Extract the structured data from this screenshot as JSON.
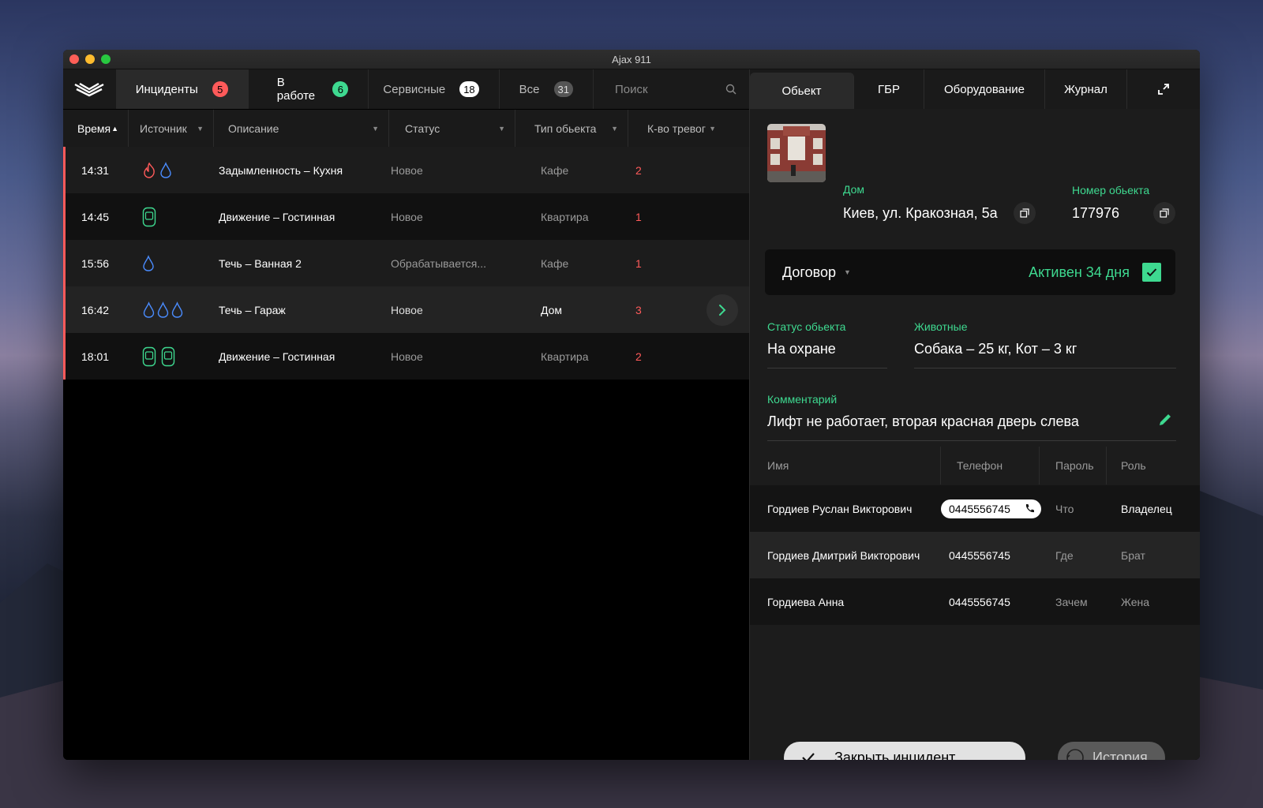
{
  "window": {
    "title": "Ajax 911"
  },
  "nav": {
    "tabs": [
      {
        "label": "Инциденты",
        "count": "5",
        "color": "#ff5a5a"
      },
      {
        "label": "В работе",
        "count": "6",
        "color": "#3ed990"
      },
      {
        "label": "Сервисные",
        "count": "18",
        "color": "#ffffff"
      },
      {
        "label": "Все",
        "count": "31",
        "color": "#555555"
      }
    ],
    "search_placeholder": "Поиск"
  },
  "table": {
    "columns": [
      "Время",
      "Источник",
      "Описание",
      "Статус",
      "Тип обьекта",
      "К-во тревог"
    ],
    "rows": [
      {
        "time": "14:31",
        "sources": [
          "fire-icon",
          "water-drop-icon"
        ],
        "description": "Задымленность – Кухня",
        "status": "Новое",
        "type": "Кафе",
        "count": "2"
      },
      {
        "time": "14:45",
        "sources": [
          "motion-sensor-icon"
        ],
        "description": "Движение – Гостинная",
        "status": "Новое",
        "type": "Квартира",
        "count": "1"
      },
      {
        "time": "15:56",
        "sources": [
          "water-drop-icon"
        ],
        "description": "Течь – Ванная 2",
        "status": "Обрабатывается...",
        "type": "Кафе",
        "count": "1"
      },
      {
        "time": "16:42",
        "sources": [
          "water-drop-icon",
          "water-drop-icon",
          "water-drop-icon"
        ],
        "description": "Течь – Гараж",
        "status": "Новое",
        "type": "Дом",
        "count": "3"
      },
      {
        "time": "18:01",
        "sources": [
          "motion-sensor-icon",
          "motion-sensor-icon"
        ],
        "description": "Движение – Гостинная",
        "status": "Новое",
        "type": "Квартира",
        "count": "2"
      }
    ]
  },
  "detail": {
    "tabs": [
      "Обьект",
      "ГБР",
      "Оборудование",
      "Журнал"
    ],
    "object_type_label": "Дом",
    "address": "Киев, ул. Кракозная, 5а",
    "number_label": "Номер обьекта",
    "number": "177976",
    "contract_label": "Договор",
    "contract_status": "Активен 34 дня",
    "status_label": "Статус обьекта",
    "status_value": "На охране",
    "animals_label": "Животные",
    "animals_value": "Собака – 25 кг, Кот – 3 кг",
    "comment_label": "Комментарий",
    "comment_value": "Лифт не работает, вторая красная дверь слева",
    "people_columns": [
      "Имя",
      "Телефон",
      "Пароль",
      "Роль"
    ],
    "people": [
      {
        "name": "Гордиев Руслан Викторович",
        "phone": "0445556745",
        "password": "Что",
        "role": "Владелец"
      },
      {
        "name": "Гордиев Дмитрий Викторович",
        "phone": "0445556745",
        "password": "Где",
        "role": "Брат"
      },
      {
        "name": "Гордиева Анна",
        "phone": "0445556745",
        "password": "Зачем",
        "role": "Жена"
      }
    ],
    "close_button": "Закрыть инцидент",
    "history_button": "История"
  },
  "colors": {
    "accent_green": "#3ed990",
    "alert_red": "#ff5a5a",
    "drop_blue": "#4a8cff"
  }
}
